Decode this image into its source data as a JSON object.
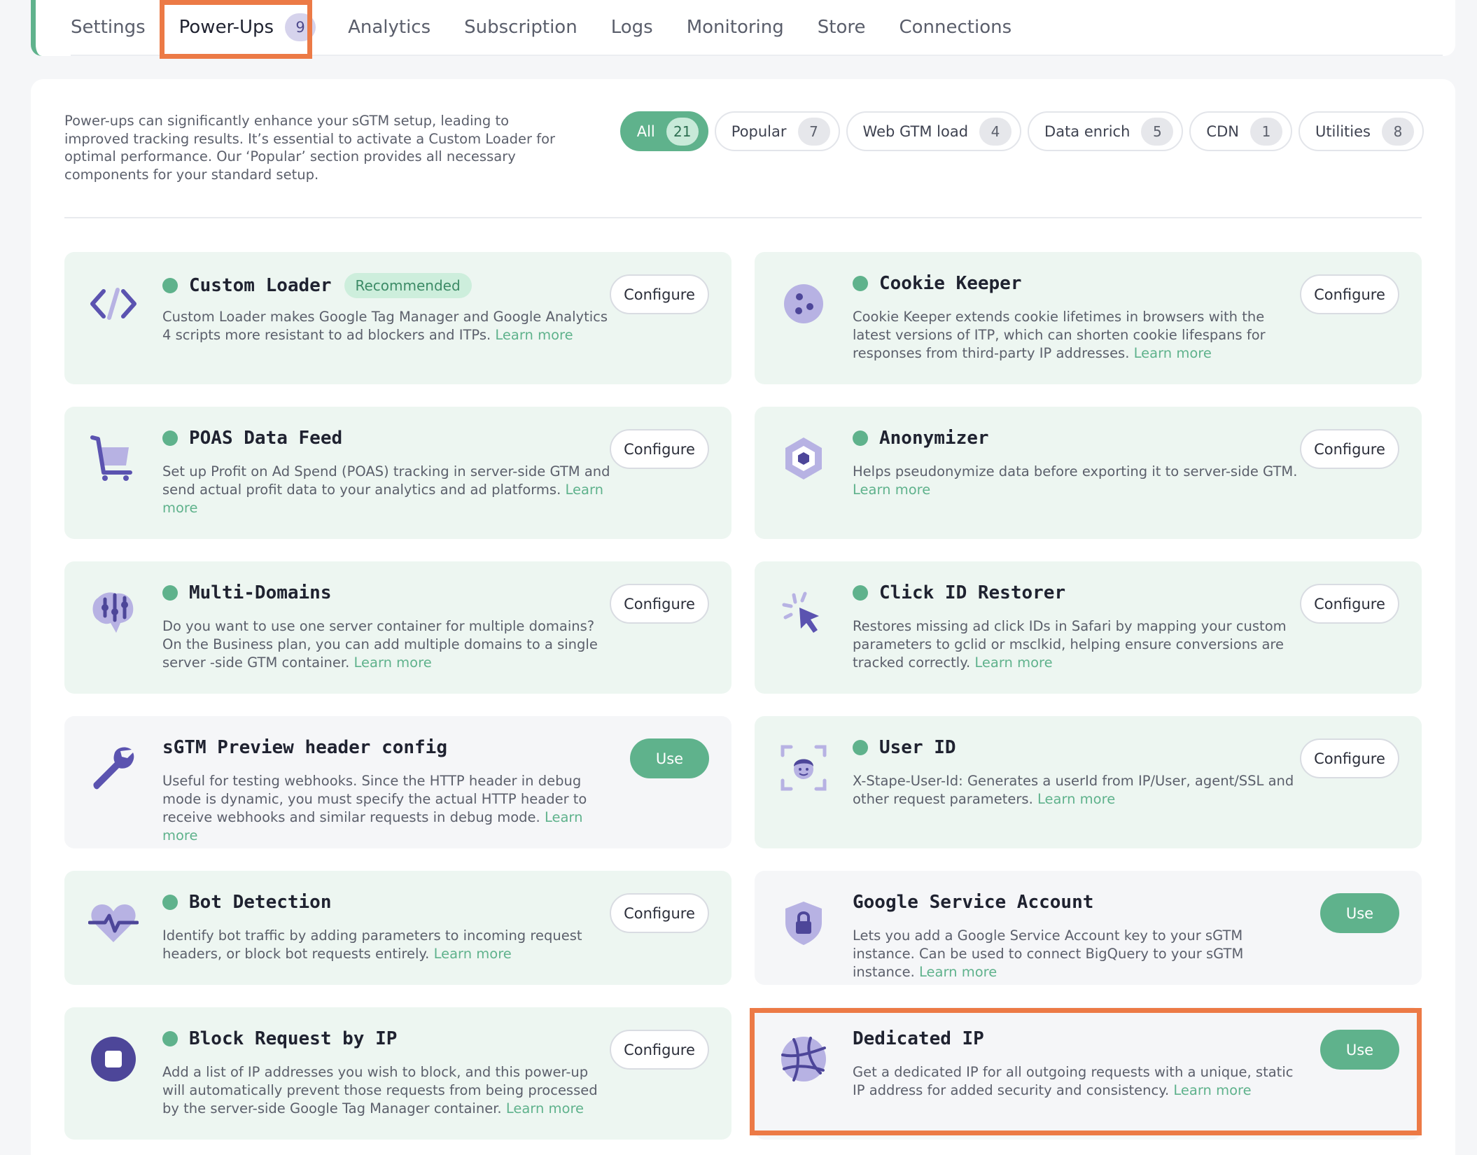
{
  "tabs": [
    {
      "label": "Settings"
    },
    {
      "label": "Power-Ups",
      "count": "9",
      "active": true
    },
    {
      "label": "Analytics"
    },
    {
      "label": "Subscription"
    },
    {
      "label": "Logs"
    },
    {
      "label": "Monitoring"
    },
    {
      "label": "Store"
    },
    {
      "label": "Connections"
    }
  ],
  "intro": "Power-ups can significantly enhance your sGTM setup, leading to improved tracking results. It’s essential to activate a Custom Loader for optimal performance. Our ‘Popular’ section provides all necessary components for your standard setup.",
  "filters": [
    {
      "label": "All",
      "count": "21",
      "active": true
    },
    {
      "label": "Popular",
      "count": "7"
    },
    {
      "label": "Web GTM load",
      "count": "4"
    },
    {
      "label": "Data enrich",
      "count": "5"
    },
    {
      "label": "CDN",
      "count": "1"
    },
    {
      "label": "Utilities",
      "count": "8"
    }
  ],
  "learn_more": "Learn more",
  "cards": [
    {
      "title": "Custom Loader",
      "badge": "Recommended",
      "active": true,
      "icon": "code-icon",
      "desc": "Custom Loader makes Google Tag Manager and Google Analytics 4 scripts more resistant to ad blockers and ITPs.",
      "button": "Configure"
    },
    {
      "title": "Cookie Keeper",
      "active": true,
      "icon": "cookie-icon",
      "desc": "Cookie Keeper extends cookie lifetimes in browsers with the latest versions of ITP, which can shorten cookie lifespans for responses from third-party IP addresses.",
      "button": "Configure"
    },
    {
      "title": "POAS Data Feed",
      "active": true,
      "icon": "cart-icon",
      "desc": "Set up Profit on Ad Spend (POAS) tracking in server-side GTM and send actual profit data to your analytics and ad platforms.",
      "button": "Configure"
    },
    {
      "title": "Anonymizer",
      "active": true,
      "icon": "hexagon-icon",
      "desc": "Helps pseudonymize data before exporting it to server-side GTM.",
      "button": "Configure"
    },
    {
      "title": "Multi-Domains",
      "active": true,
      "icon": "brain-icon",
      "desc": "Do you want to use one server container for multiple domains? On the Business plan, you can add multiple domains to a single server -side GTM container.",
      "button": "Configure"
    },
    {
      "title": "Click ID Restorer",
      "active": true,
      "icon": "cursor-click-icon",
      "desc": "Restores missing ad click IDs in Safari by mapping your custom parameters to gclid or msclkid, helping ensure conversions are tracked correctly.",
      "button": "Configure"
    },
    {
      "title": "sGTM Preview header config",
      "active": false,
      "icon": "wrench-icon",
      "desc": "Useful for testing webhooks. Since the HTTP header in debug mode is dynamic, you must specify the actual HTTP header to receive webhooks and similar requests in debug mode.",
      "button": "Use"
    },
    {
      "title": "User ID",
      "active": true,
      "icon": "face-scan-icon",
      "desc": "X-Stape-User-Id: Generates a userId from IP/User, agent/SSL and other request parameters.",
      "button": "Configure"
    },
    {
      "title": "Bot Detection",
      "active": true,
      "icon": "heartbeat-icon",
      "desc": "Identify bot traffic by adding parameters to incoming request headers, or block bot requests entirely.",
      "button": "Configure"
    },
    {
      "title": "Google Service Account",
      "active": false,
      "icon": "shield-lock-icon",
      "desc": "Lets you add a Google Service Account key to your sGTM instance. Can be used to connect BigQuery to your sGTM instance.",
      "button": "Use"
    },
    {
      "title": "Block Request by IP",
      "active": true,
      "icon": "stop-icon",
      "desc": "Add a list of IP addresses you wish to block, and this power-up will automatically prevent those requests from being processed by the server-side Google Tag Manager container.",
      "button": "Configure"
    },
    {
      "title": "Dedicated IP",
      "active": false,
      "icon": "network-globe-icon",
      "desc": "Get a dedicated IP for all outgoing requests with a unique, static IP address for added security and consistency.",
      "button": "Use"
    }
  ]
}
